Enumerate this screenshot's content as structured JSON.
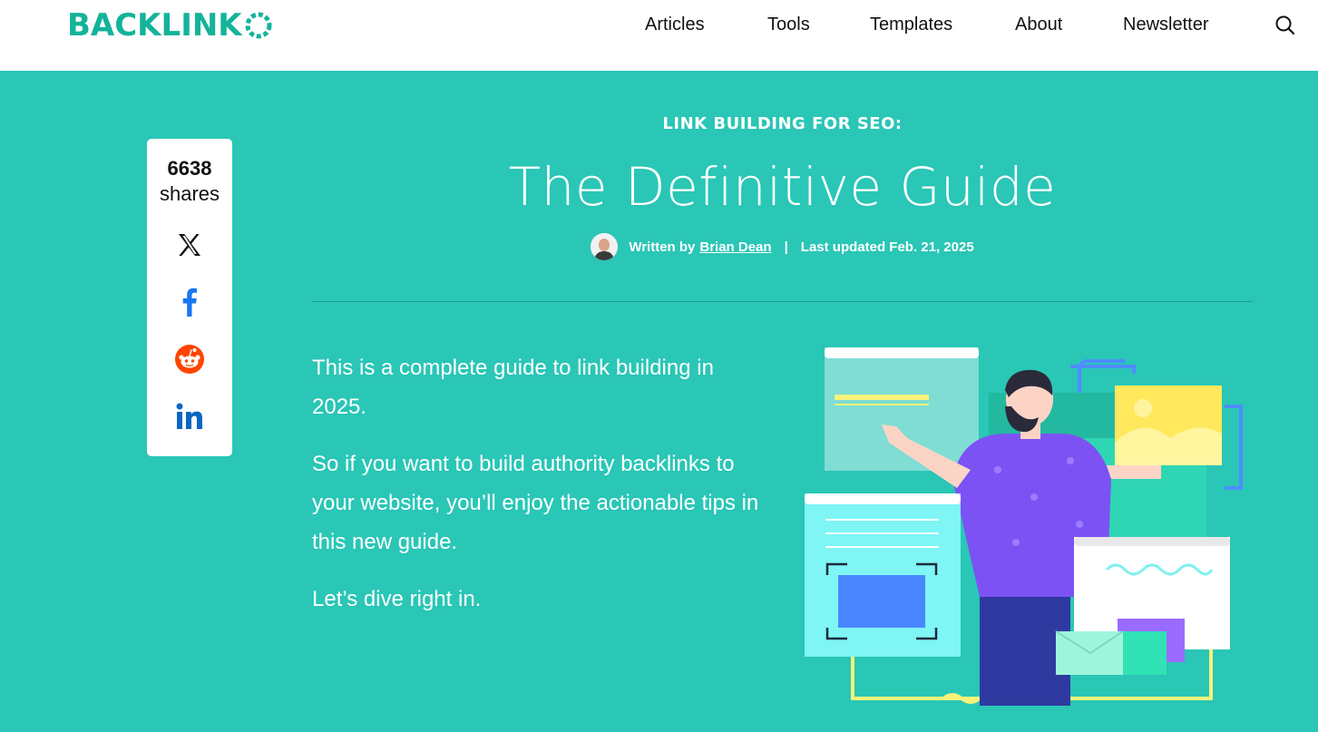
{
  "brand": {
    "logo_text": "BACKLINK",
    "accent": "#14b39a",
    "hero_bg": "#2ac6b6"
  },
  "nav": {
    "items": [
      {
        "label": "Articles"
      },
      {
        "label": "Tools"
      },
      {
        "label": "Templates"
      },
      {
        "label": "About"
      },
      {
        "label": "Newsletter"
      }
    ],
    "search_icon": "search-icon"
  },
  "share": {
    "count": "6638",
    "label": "shares",
    "icons": [
      "x-icon",
      "facebook-icon",
      "reddit-icon",
      "linkedin-icon"
    ]
  },
  "article": {
    "eyebrow": "LINK BUILDING FOR SEO:",
    "title": "The Definitive Guide",
    "byline_prefix": "Written by",
    "author": "Brian Dean",
    "separator": "|",
    "updated": "Last updated Feb. 21, 2025",
    "intro": [
      "This is a complete guide to link building in 2025.",
      "So if you want to build authority backlinks to your website, you’ll enjoy the actionable tips in this new guide.",
      "Let’s dive right in."
    ]
  }
}
